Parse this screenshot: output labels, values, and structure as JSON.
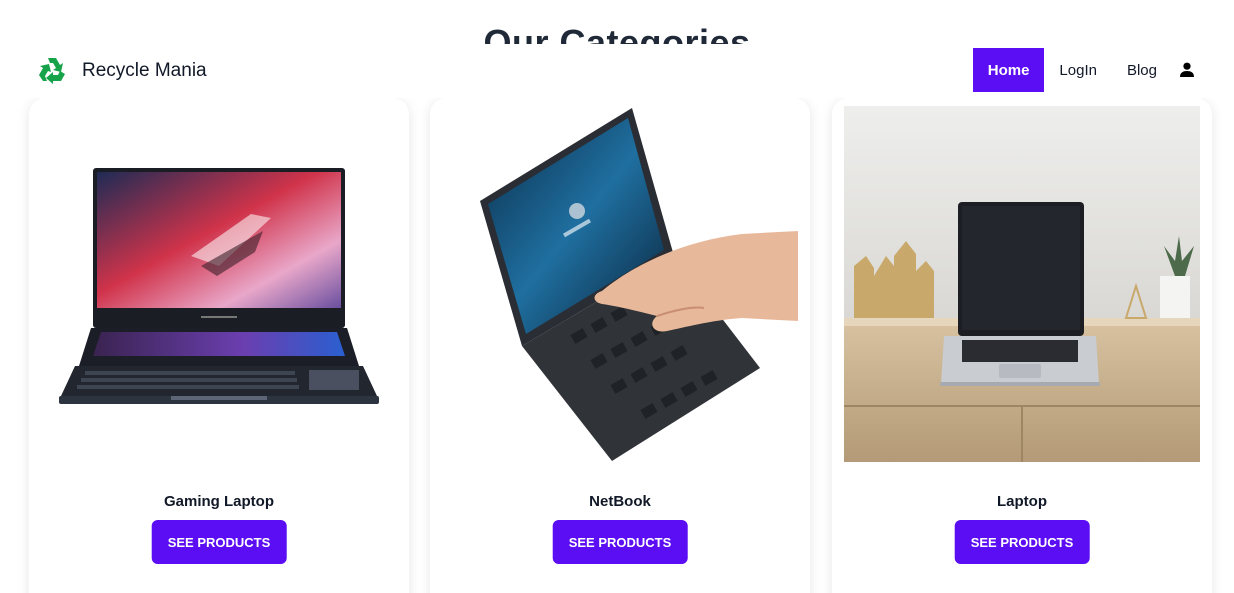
{
  "section": {
    "title": "Our Categories"
  },
  "brand": {
    "name": "Recycle Mania",
    "icon": "recycle-icon",
    "icon_color": "#16a34a"
  },
  "nav": {
    "items": [
      {
        "label": "Home",
        "active": true
      },
      {
        "label": "LogIn",
        "active": false
      },
      {
        "label": "Blog",
        "active": false
      }
    ],
    "user_icon": "user-icon"
  },
  "colors": {
    "accent": "#5b0df3"
  },
  "categories": [
    {
      "title": "Gaming Laptop",
      "button": "SEE PRODUCTS",
      "image": "gaming-laptop-image"
    },
    {
      "title": "NetBook",
      "button": "SEE PRODUCTS",
      "image": "netbook-image"
    },
    {
      "title": "Laptop",
      "button": "SEE PRODUCTS",
      "image": "laptop-on-desk-image"
    }
  ]
}
